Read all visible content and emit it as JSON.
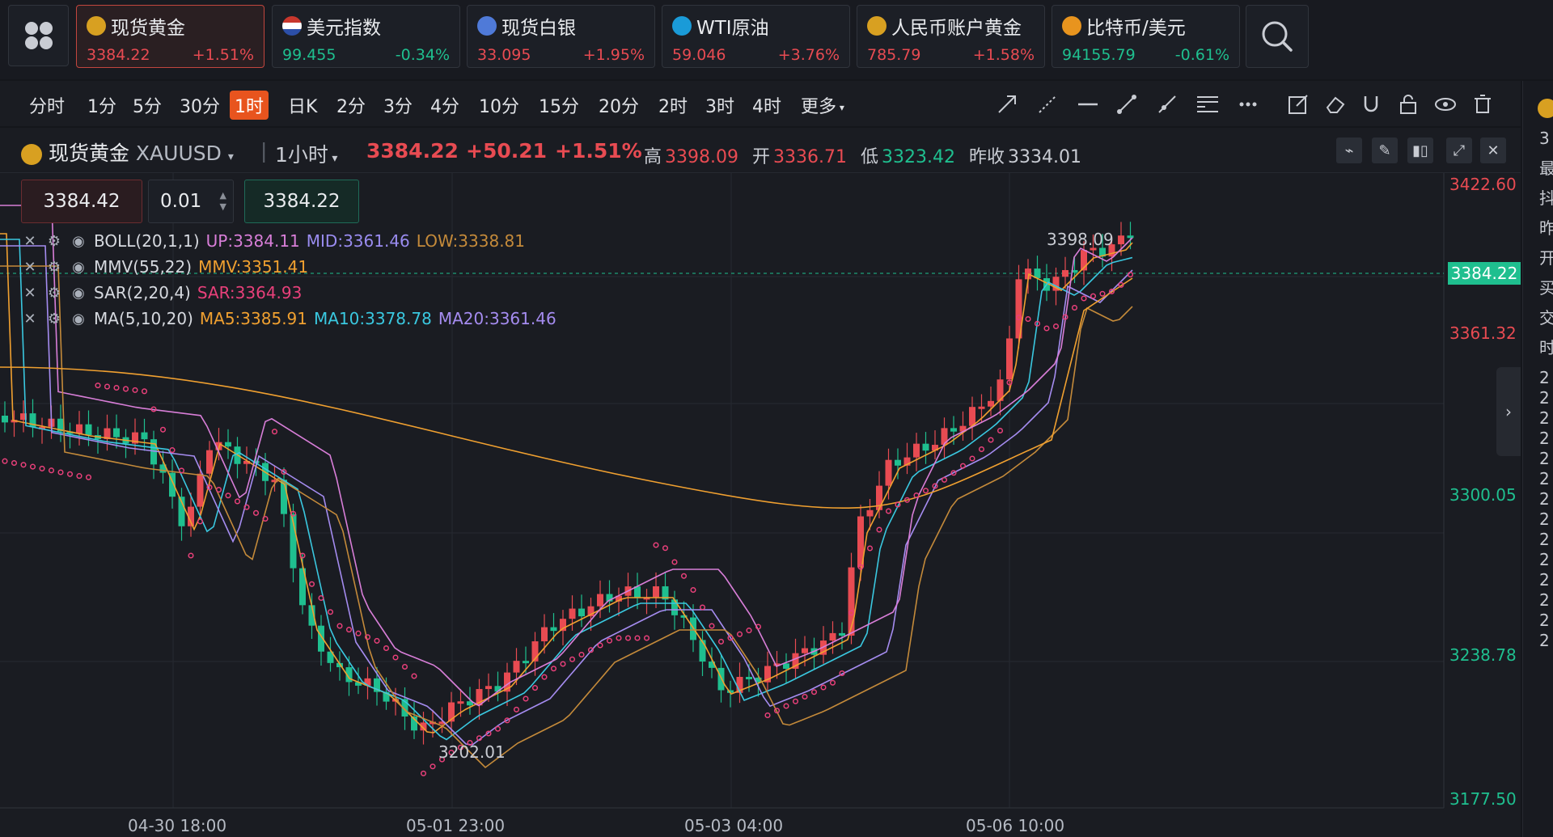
{
  "tickers": [
    {
      "name": "现货黄金",
      "price": "3384.22",
      "change": "+1.51%",
      "dir": "up",
      "icon": "gold-icon",
      "color": "#d8a021"
    },
    {
      "name": "美元指数",
      "price": "99.455",
      "change": "-0.34%",
      "dir": "down",
      "icon": "us-flag-icon",
      "color": "#c8372d"
    },
    {
      "name": "现货白银",
      "price": "33.095",
      "change": "+1.95%",
      "dir": "up",
      "icon": "silver-icon",
      "color": "#4f7ad8"
    },
    {
      "name": "WTI原油",
      "price": "59.046",
      "change": "+3.76%",
      "dir": "up",
      "icon": "oil-icon",
      "color": "#1a9bd8"
    },
    {
      "name": "人民币账户黄金",
      "price": "785.79",
      "change": "+1.58%",
      "dir": "up",
      "icon": "gold-icon",
      "color": "#d8a021"
    },
    {
      "name": "比特币/美元",
      "price": "94155.79",
      "change": "-0.61%",
      "dir": "down",
      "icon": "bitcoin-icon",
      "color": "#e8941e"
    }
  ],
  "periods": [
    "分时",
    "1分",
    "5分",
    "30分",
    "1时",
    "日K",
    "2分",
    "3分",
    "4分",
    "10分",
    "15分",
    "20分",
    "2时",
    "3时",
    "4时",
    "更多"
  ],
  "active_period": "1时",
  "header": {
    "symbol_name": "现货黄金",
    "symbol_code": "XAUUSD",
    "interval": "1小时",
    "price": "3384.22",
    "change": "+50.21",
    "change_pct": "+1.51%",
    "high_label": "高",
    "high": "3398.09",
    "open_label": "开",
    "open": "3336.71",
    "low_label": "低",
    "low": "3323.42",
    "prev_label": "昨收",
    "prev": "3334.01"
  },
  "order": {
    "sell_price": "3384.42",
    "lot": "0.01",
    "buy_price": "3384.22"
  },
  "indicators": [
    {
      "name": "BOLL(20,1,1)",
      "values": [
        {
          "label": "UP:3384.11",
          "color": "#d87ed8"
        },
        {
          "label": "MID:3361.46",
          "color": "#9a8cf0"
        },
        {
          "label": "LOW:3338.81",
          "color": "#c48a3a"
        }
      ]
    },
    {
      "name": "MMV(55,22)",
      "values": [
        {
          "label": "MMV:3351.41",
          "color": "#f0a030"
        }
      ]
    },
    {
      "name": "SAR(2,20,4)",
      "values": [
        {
          "label": "SAR:3364.93",
          "color": "#e8407a"
        }
      ]
    },
    {
      "name": "MA(5,10,20)",
      "values": [
        {
          "label": "MA5:3385.91",
          "color": "#f0a030"
        },
        {
          "label": "MA10:3378.78",
          "color": "#3ac8e0"
        },
        {
          "label": "MA20:3361.46",
          "color": "#a58cf0"
        }
      ]
    }
  ],
  "axis": {
    "prices": [
      "3422.60",
      "3361.32",
      "3300.05",
      "3238.78",
      "3177.50"
    ],
    "current_price_tag": "3384.22",
    "times": [
      "04-30 18:00",
      "05-01 23:00",
      "05-03 04:00",
      "05-06 10:00"
    ]
  },
  "annotations": {
    "high": "3398.09",
    "low": "3202.01"
  },
  "right_panel_text": [
    "3",
    "最",
    "抖",
    "昨",
    "开",
    "买",
    "交",
    "时",
    "2",
    "2",
    "2",
    "2",
    "2",
    "2",
    "2",
    "2",
    "2",
    "2",
    "2",
    "2",
    "2",
    "2"
  ]
}
